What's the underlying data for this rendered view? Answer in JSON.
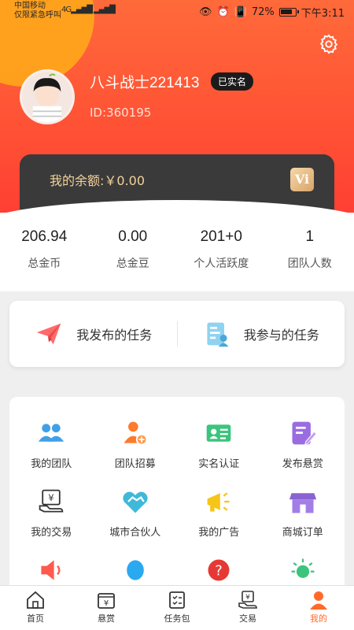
{
  "status_bar": {
    "carrier_line1": "中国移动",
    "carrier_line2": "仅限紧急呼叫",
    "network": "4G",
    "battery": "72%",
    "time": "下午3:11"
  },
  "profile": {
    "nickname": "八斗战士221413",
    "verified_badge": "已实名",
    "user_id": "ID:360195"
  },
  "balance": {
    "label": "我的余额:￥0.00",
    "vip_icon": "Vi"
  },
  "stats": [
    {
      "value": "206.94",
      "label": "总金币"
    },
    {
      "value": "0.00",
      "label": "总金豆"
    },
    {
      "value": "201+0",
      "label": "个人活跃度"
    },
    {
      "value": "1",
      "label": "团队人数"
    }
  ],
  "tasks": {
    "published": "我发布的任务",
    "joined": "我参与的任务"
  },
  "grid": [
    {
      "label": "我的团队",
      "icon": "team-icon"
    },
    {
      "label": "团队招募",
      "icon": "recruit-icon"
    },
    {
      "label": "实名认证",
      "icon": "id-card-icon"
    },
    {
      "label": "发布悬赏",
      "icon": "post-reward-icon"
    },
    {
      "label": "我的交易",
      "icon": "trade-icon"
    },
    {
      "label": "城市合伙人",
      "icon": "handshake-icon"
    },
    {
      "label": "我的广告",
      "icon": "megaphone-icon"
    },
    {
      "label": "商城订单",
      "icon": "shop-icon"
    }
  ],
  "nav": [
    {
      "label": "首页",
      "icon": "home-icon"
    },
    {
      "label": "悬赏",
      "icon": "reward-icon"
    },
    {
      "label": "任务包",
      "icon": "task-package-icon"
    },
    {
      "label": "交易",
      "icon": "trade-icon"
    },
    {
      "label": "我的",
      "icon": "user-icon"
    }
  ],
  "colors": {
    "accent": "#ff6a2b",
    "header_top": "#ff6a3a",
    "header_bottom": "#ff3f33",
    "card_dark": "#3a3a3a"
  }
}
